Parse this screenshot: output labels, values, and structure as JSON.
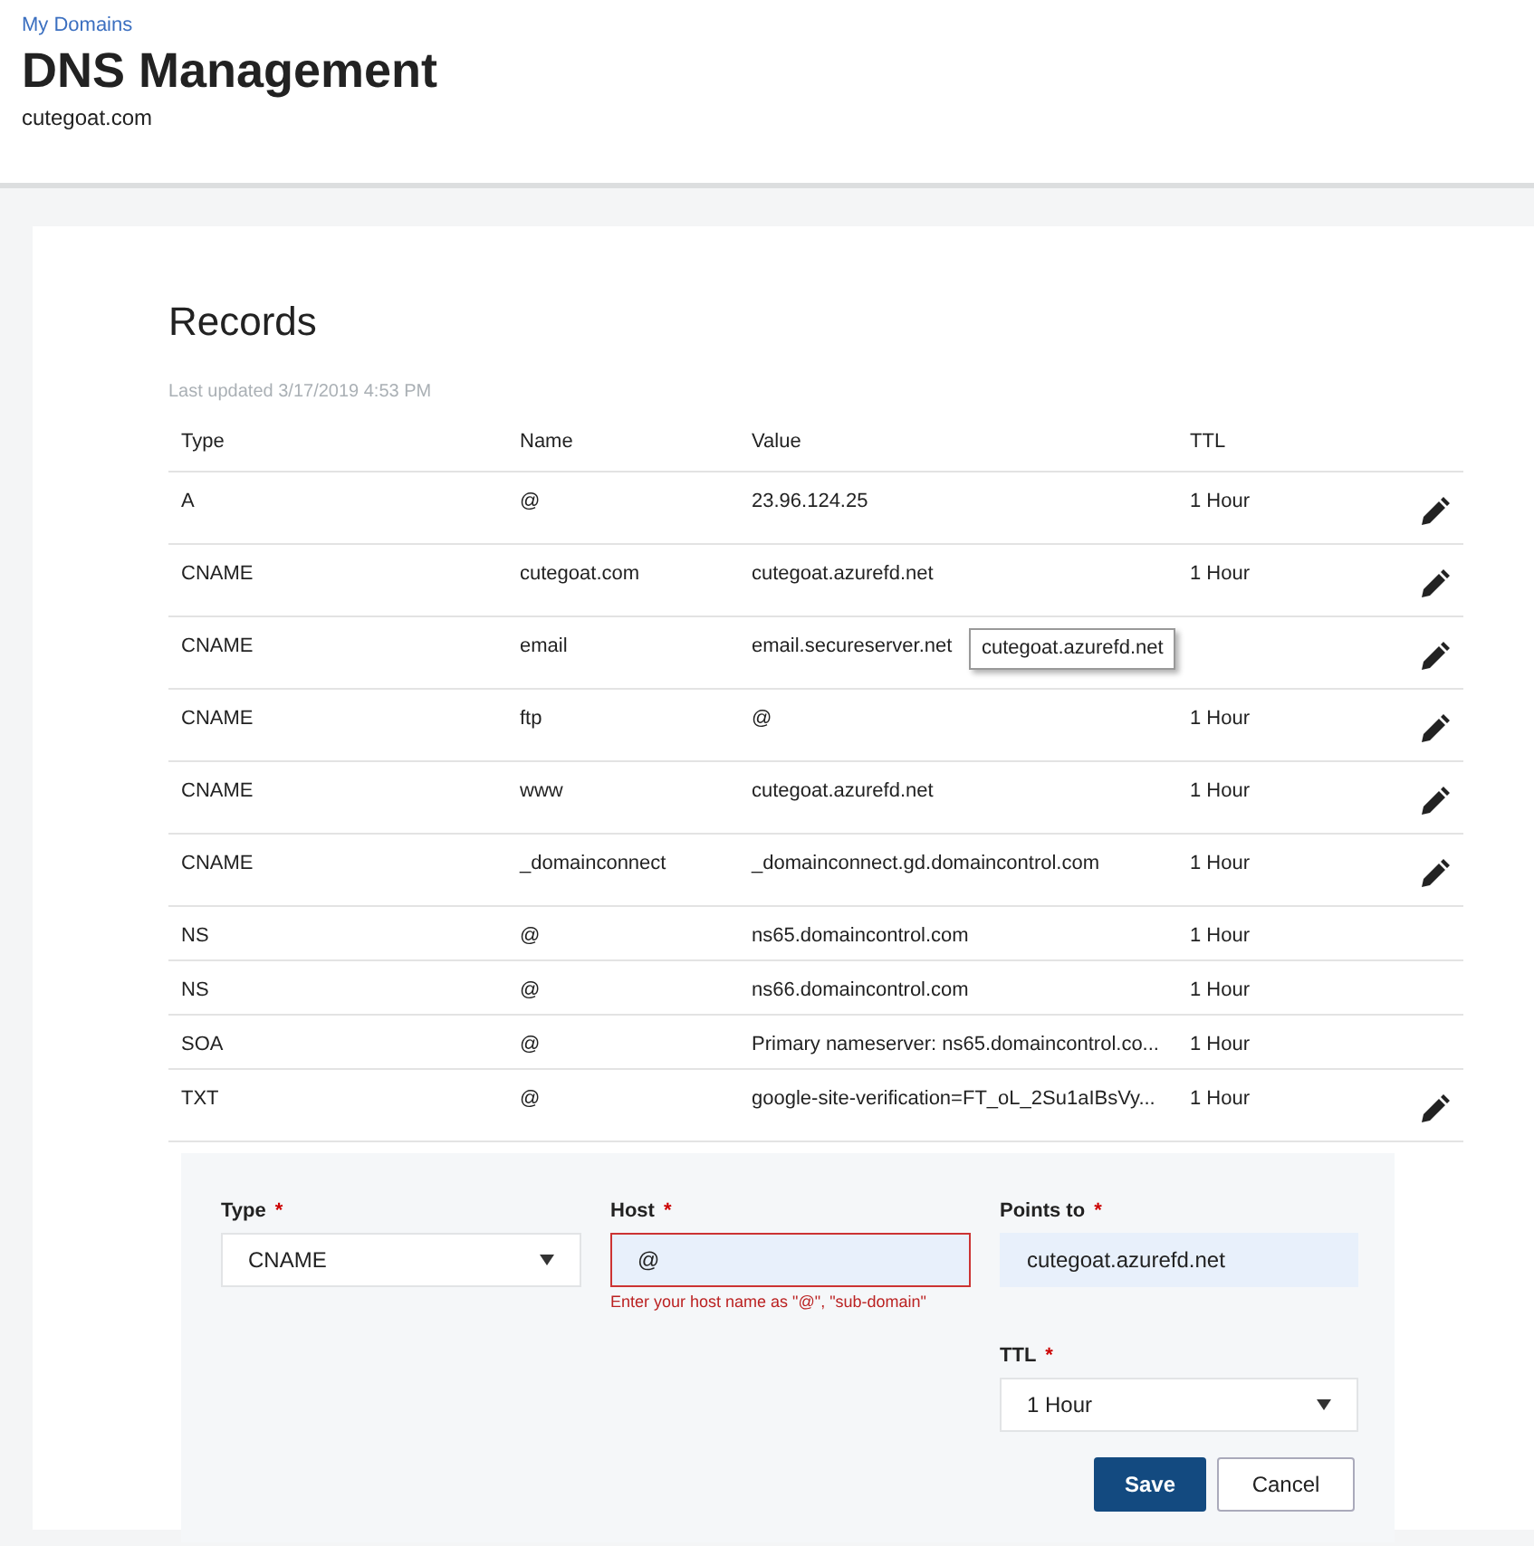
{
  "breadcrumb": "My Domains",
  "title": "DNS Management",
  "domain": "cutegoat.com",
  "records": {
    "title": "Records",
    "last_updated": "Last updated 3/17/2019 4:53 PM",
    "columns": [
      "Type",
      "Name",
      "Value",
      "TTL"
    ],
    "rows": [
      {
        "type": "A",
        "name": "@",
        "value": "23.96.124.25",
        "ttl": "1 Hour",
        "editable": true
      },
      {
        "type": "CNAME",
        "name": "cutegoat.com",
        "value": "cutegoat.azurefd.net",
        "ttl": "1 Hour",
        "editable": true
      },
      {
        "type": "CNAME",
        "name": "email",
        "value": "email.secureserver.net",
        "ttl": "",
        "editable": true,
        "tooltip": "cutegoat.azurefd.net"
      },
      {
        "type": "CNAME",
        "name": "ftp",
        "value": "@",
        "ttl": "1 Hour",
        "editable": true
      },
      {
        "type": "CNAME",
        "name": "www",
        "value": "cutegoat.azurefd.net",
        "ttl": "1 Hour",
        "editable": true
      },
      {
        "type": "CNAME",
        "name": "_domainconnect",
        "value": "_domainconnect.gd.domaincontrol.com",
        "ttl": "1 Hour",
        "editable": true
      },
      {
        "type": "NS",
        "name": "@",
        "value": "ns65.domaincontrol.com",
        "ttl": "1 Hour",
        "editable": false
      },
      {
        "type": "NS",
        "name": "@",
        "value": "ns66.domaincontrol.com",
        "ttl": "1 Hour",
        "editable": false
      },
      {
        "type": "SOA",
        "name": "@",
        "value": "Primary nameserver: ns65.domaincontrol.co...",
        "ttl": "1 Hour",
        "editable": false
      },
      {
        "type": "TXT",
        "name": "@",
        "value": "google-site-verification=FT_oL_2Su1aIBsVy...",
        "ttl": "1 Hour",
        "editable": true
      }
    ]
  },
  "form": {
    "fields": [
      {
        "kind": "select",
        "label": "Type",
        "required_mark": "*",
        "value": "CNAME",
        "invalid": false
      },
      {
        "kind": "input",
        "label": "Host",
        "required_mark": "*",
        "value": "@",
        "invalid": true,
        "error": "Enter your host name as \"@\", \"sub-domain\""
      },
      {
        "kind": "input",
        "label": "Points to",
        "required_mark": "*",
        "value": "cutegoat.azurefd.net",
        "invalid": false
      },
      {
        "kind": "select",
        "label": "TTL",
        "required_mark": "*",
        "value": "1 Hour",
        "invalid": false
      }
    ],
    "buttons": [
      {
        "label": "Save",
        "primary": true
      },
      {
        "label": "Cancel",
        "primary": false
      }
    ]
  }
}
